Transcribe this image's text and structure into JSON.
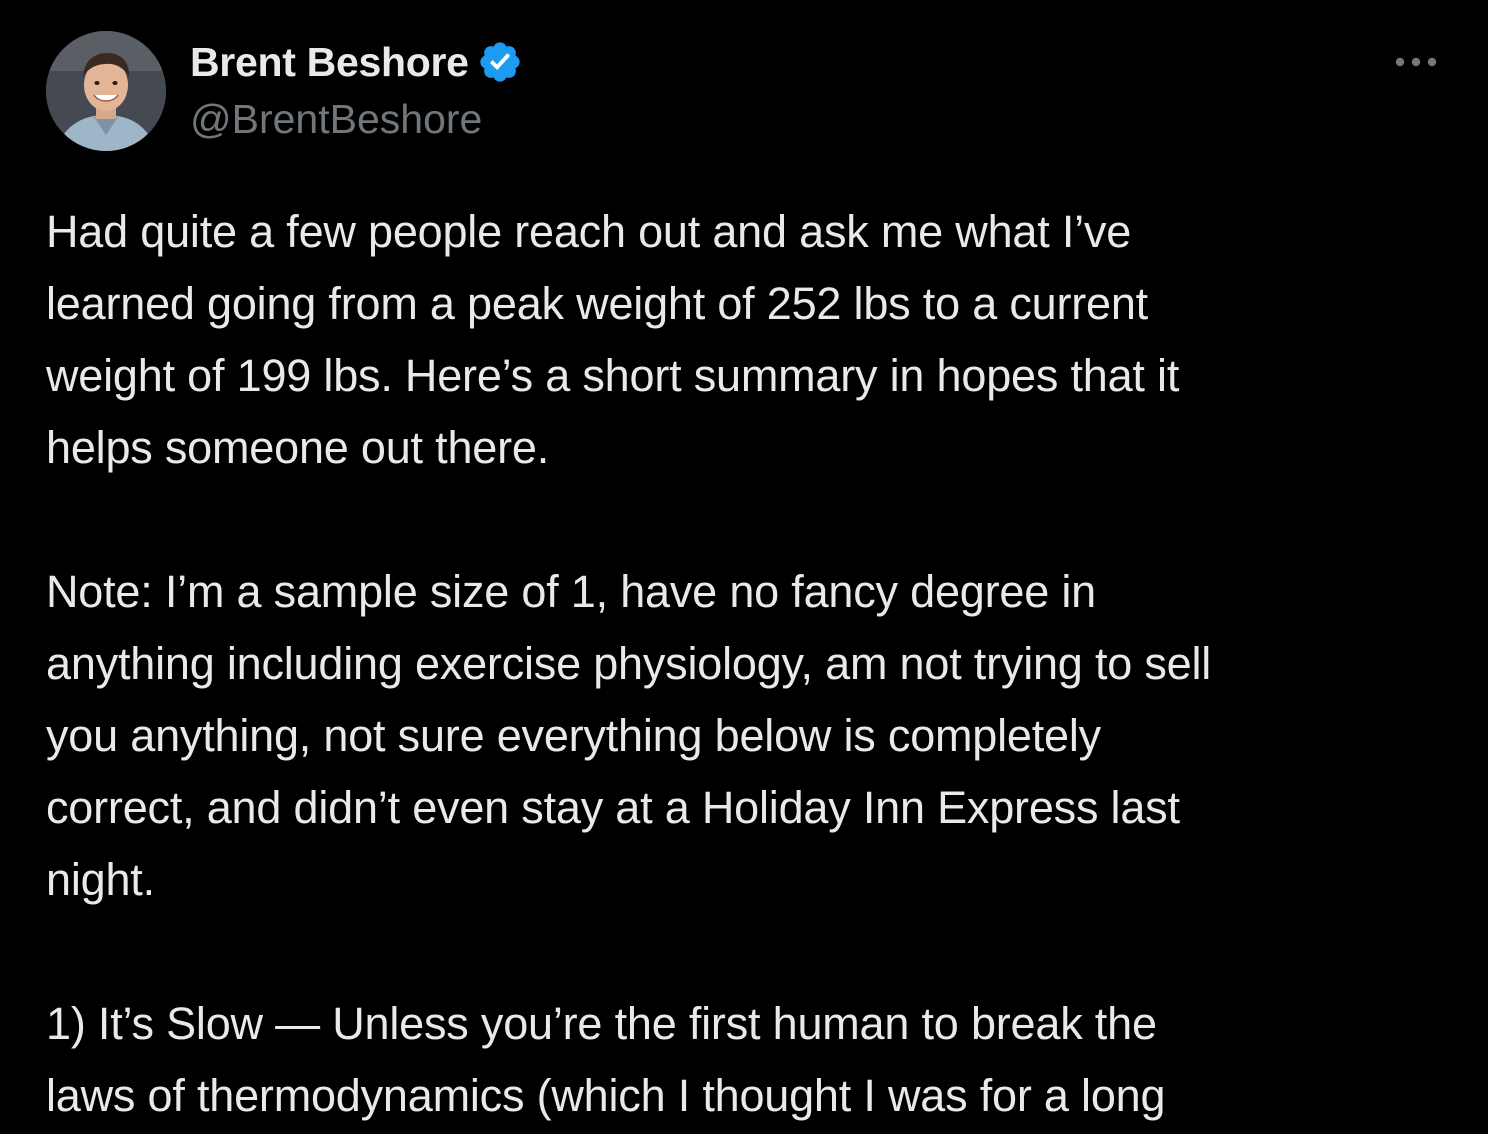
{
  "tweet": {
    "author": {
      "name": "Brent Beshore",
      "handle": "@BrentBeshore",
      "verified": true,
      "avatar_icon": "profile-photo"
    },
    "more_icon": "more-horizontal-icon",
    "paragraphs": [
      "Had quite a few people reach out and ask me what I’ve\nlearned going from a peak weight of 252 lbs to a current\nweight of 199 lbs. Here’s a short summary in hopes that it\nhelps someone out there.",
      "Note: I’m a sample size of 1, have no fancy degree in\nanything including exercise physiology, am not trying to sell\nyou anything, not sure everything below is completely\ncorrect, and didn’t even stay at a Holiday Inn Express last\nnight.",
      "1) It’s Slow — Unless you’re the first human to break the\nlaws of thermodynamics (which I thought I was for a long"
    ]
  },
  "colors": {
    "background": "#000000",
    "text_primary": "#e7e9ea",
    "text_secondary": "#71767b",
    "verified_badge": "#1d9bf0"
  }
}
